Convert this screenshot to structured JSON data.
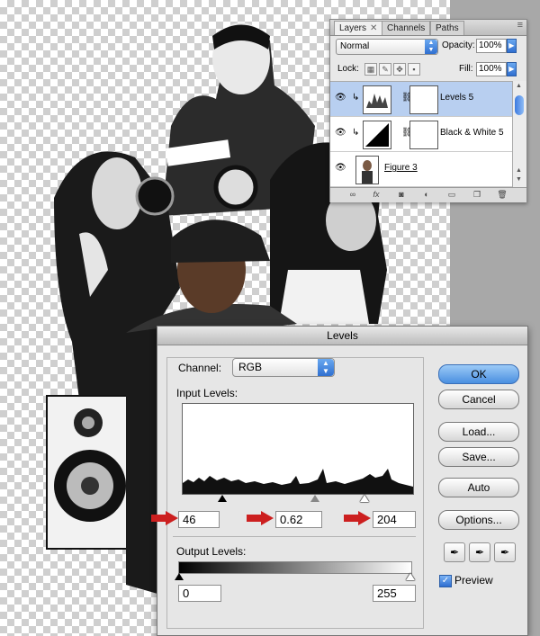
{
  "layers_panel": {
    "tabs": [
      {
        "label": "Layers"
      },
      {
        "label": "Channels"
      },
      {
        "label": "Paths"
      }
    ],
    "blend_mode": "Normal",
    "opacity_label": "Opacity:",
    "opacity_value": "100%",
    "lock_label": "Lock:",
    "fill_label": "Fill:",
    "fill_value": "100%",
    "layers": [
      {
        "name": "Levels 5",
        "selected": true
      },
      {
        "name": "Black & White 5",
        "selected": false
      },
      {
        "name": "Figure 3",
        "selected": false
      }
    ],
    "footer_icons": [
      "link-icon",
      "fx-icon",
      "mask-icon",
      "adjustment-icon",
      "group-folder-icon",
      "new-layer-icon",
      "trash-icon"
    ]
  },
  "levels_dialog": {
    "title": "Levels",
    "channel_label": "Channel:",
    "channel_value": "RGB",
    "input_levels_label": "Input Levels:",
    "input_black": "46",
    "input_gamma": "0.62",
    "input_white": "204",
    "output_levels_label": "Output Levels:",
    "output_black": "0",
    "output_white": "255",
    "buttons": {
      "ok": "OK",
      "cancel": "Cancel",
      "load": "Load...",
      "save": "Save...",
      "auto": "Auto",
      "options": "Options..."
    },
    "preview_label": "Preview",
    "preview_checked": true
  },
  "colors": {
    "selection_blue": "#b8cff0",
    "default_button_blue": "#4a8fe0",
    "arrow_red": "#cc1f1f"
  }
}
